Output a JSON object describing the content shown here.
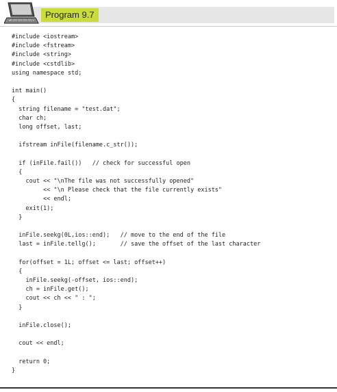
{
  "header": {
    "title": "Program 9.7",
    "icon": "laptop-icon",
    "accent_color": "#c9dc3b",
    "band_color": "#e6e6e6"
  },
  "code_lines": [
    "#include <iostream>",
    "#include <fstream>",
    "#include <string>",
    "#include <cstdlib>",
    "using namespace std;",
    "",
    "int main()",
    "{",
    "  string filename = \"test.dat\";",
    "  char ch;",
    "  long offset, last;",
    "",
    "  ifstream inFile(filename.c_str());",
    "",
    "  if (inFile.fail())   // check for successful open",
    "  {",
    "    cout << \"\\nThe file was not successfully opened\"",
    "         << \"\\n Please check that the file currently exists\"",
    "         << endl;",
    "    exit(1);",
    "  }",
    "",
    "  inFile.seekg(0L,ios::end);   // move to the end of the file",
    "  last = inFile.tellg();       // save the offset of the last character",
    "",
    "  for(offset = 1L; offset <= last; offset++)",
    "  {",
    "    inFile.seekg(-offset, ios::end);",
    "    ch = inFile.get();",
    "    cout << ch << \" : \";",
    "  }",
    "",
    "  inFile.close();",
    "",
    "  cout << endl;",
    "",
    "  return 0;",
    "}"
  ]
}
